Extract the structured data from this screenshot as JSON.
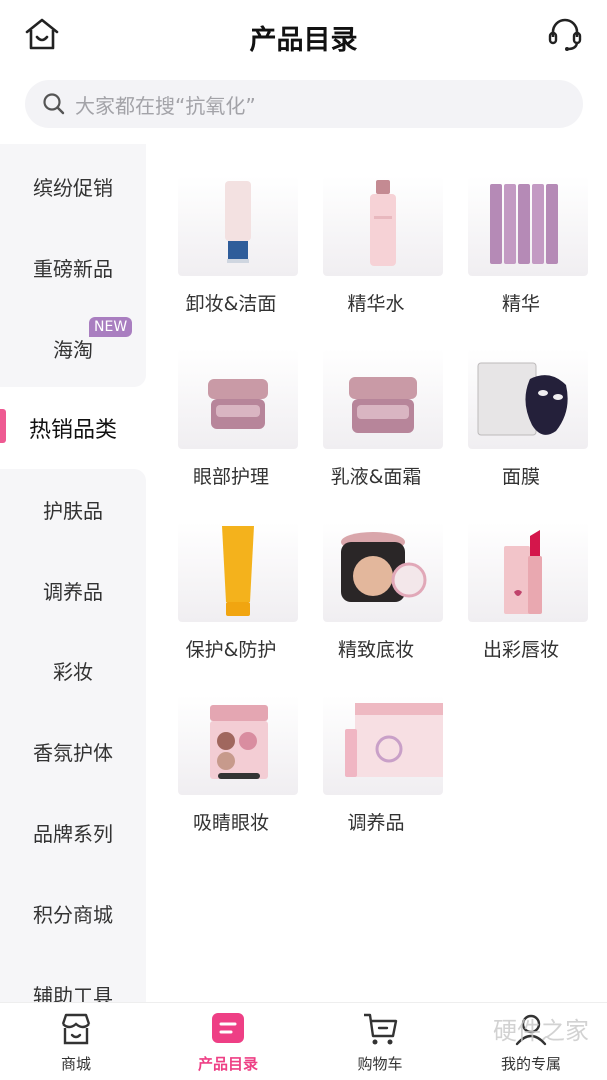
{
  "header": {
    "title": "产品目录",
    "home_icon": "home-icon",
    "service_icon": "headset-icon"
  },
  "search": {
    "placeholder": "大家都在搜“抗氧化”",
    "icon": "search-icon"
  },
  "sidebar": {
    "items": [
      {
        "label": "缤纷促销"
      },
      {
        "label": "重磅新品"
      },
      {
        "label": "海淘",
        "badge": "NEW"
      },
      {
        "label": "热销品类",
        "active": true
      },
      {
        "label": "护肤品"
      },
      {
        "label": "调养品"
      },
      {
        "label": "彩妆"
      },
      {
        "label": "香氛护体"
      },
      {
        "label": "品牌系列"
      },
      {
        "label": "积分商城"
      },
      {
        "label": "辅助工具"
      }
    ],
    "active_color": "#ee5a92"
  },
  "products": [
    {
      "label": "卸妆&洁面"
    },
    {
      "label": "精华水"
    },
    {
      "label": "精华"
    },
    {
      "label": "眼部护理"
    },
    {
      "label": "乳液&面霜"
    },
    {
      "label": "面膜"
    },
    {
      "label": "保护&防护"
    },
    {
      "label": "精致底妆"
    },
    {
      "label": "出彩唇妆"
    },
    {
      "label": "吸睛眼妆"
    },
    {
      "label": "调养品"
    }
  ],
  "bottom_nav": {
    "items": [
      {
        "label": "商城",
        "icon": "store-icon"
      },
      {
        "label": "产品目录",
        "icon": "catalog-icon",
        "active": true
      },
      {
        "label": "购物车",
        "icon": "cart-icon"
      },
      {
        "label": "我的专属",
        "icon": "profile-icon"
      }
    ],
    "active_color": "#ee3f85"
  },
  "watermark": "硬件之家"
}
